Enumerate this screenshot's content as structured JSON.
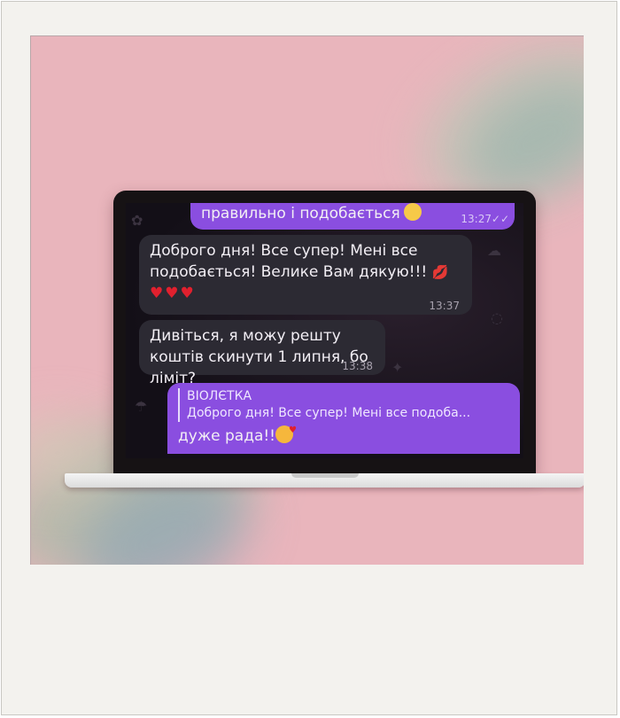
{
  "chat": {
    "top_message": {
      "text": "правильно і подобається",
      "time": "13:27",
      "read_status": "✓✓"
    },
    "messages": [
      {
        "direction": "incoming",
        "text": "Доброго дня! Все супер! Мені все подобається! Велике Вам дякую!!!",
        "emoji": "💋",
        "hearts": "♥♥♥",
        "time": "13:37"
      },
      {
        "direction": "incoming",
        "text": "Дивіться, я можу решту коштів скинути 1 липня, бо ліміт?",
        "time": "13:38"
      },
      {
        "direction": "outgoing",
        "reply_author": "ВІОЛЄТКА",
        "reply_text": "Доброго дня! Все супер! Мені все подоба...",
        "text": "дуже рада!!"
      }
    ]
  },
  "colors": {
    "photo_background": "#e9b5bc",
    "outgoing_bubble": "#8a4ee0",
    "incoming_bubble": "#2c2a33",
    "frame": "#f3f2ee"
  },
  "icons": [
    "smiling-face-icon",
    "double-check-icon",
    "kiss-mark-icon",
    "heart-icon",
    "smiling-face-with-hearts-icon"
  ]
}
